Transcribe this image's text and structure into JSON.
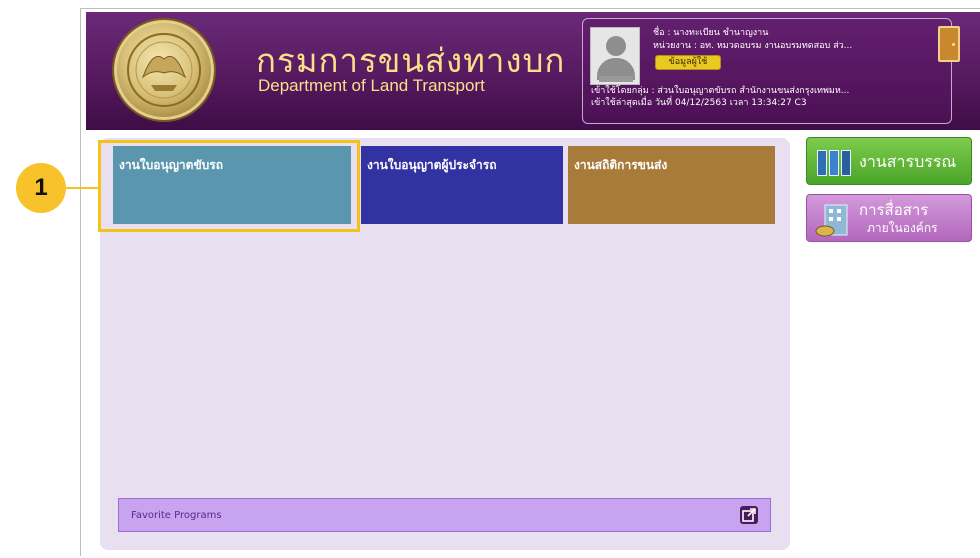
{
  "header": {
    "title_th": "กรมการขนส่งทางบก",
    "title_en": "Department of Land Transport"
  },
  "user": {
    "name_label": "ชื่อ : ",
    "name_value": "นางทะเบียน ชำนาญงาน",
    "unit_label": "หน่วยงาน : ",
    "unit_value": "อท. หมวดอบรม งานอบรมทดสอบ ส่ว...",
    "info_button": "ข้อมูลผู้ใช้",
    "group_line": "เข้าใช้โดยกลุ่ม : ส่วนใบอนุญาตขับรถ สำนักงานขนส่งกรุงเทพมห...",
    "last_login_line": "เข้าใช้ล่าสุดเมื่อ วันที่ 04/12/2563 เวลา 13:34:27 C3"
  },
  "tiles": [
    {
      "label": "งานใบอนุญาตขับรถ",
      "color": "#5a97ae"
    },
    {
      "label": "งานใบอนุญาตผู้ประจำรถ",
      "color": "#3232a2"
    },
    {
      "label": "งานสถิติการขนส่ง",
      "color": "#a97b3a"
    }
  ],
  "sidebar": {
    "doc_button": "งานสารบรรณ",
    "comm_button": "การสื่อสาร",
    "comm_sub": "ภายในองค์กร"
  },
  "favorites": {
    "label": "Favorite Programs"
  },
  "callout": {
    "number": "1",
    "color": "#f4c21a"
  },
  "icons": {
    "seal": "department-seal-icon",
    "exit": "door-exit-icon",
    "avatar": "user-avatar-icon",
    "open": "open-external-icon",
    "binders": "binders-icon",
    "building": "building-icon"
  }
}
